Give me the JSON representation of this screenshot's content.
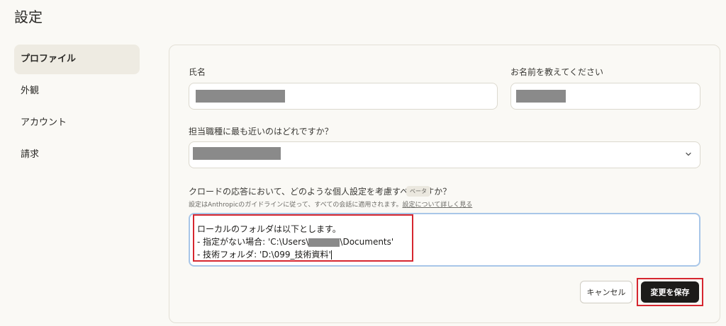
{
  "page": {
    "title": "設定"
  },
  "sidebar": {
    "items": [
      {
        "label": "プロファイル",
        "active": true
      },
      {
        "label": "外観",
        "active": false
      },
      {
        "label": "アカウント",
        "active": false
      },
      {
        "label": "請求",
        "active": false
      }
    ]
  },
  "profile": {
    "full_name_label": "氏名",
    "full_name_value": "",
    "nickname_label": "お名前を教えてください",
    "nickname_value": "",
    "role_label": "担当職種に最も近いのはどれですか？",
    "role_value": "",
    "preferences_label": "クロードの応答において、どのような個人設定を考慮すべきですか？",
    "beta_badge": "ベータ",
    "preferences_note": "設定はAnthropicのガイドラインに従って、すべての会話に適用されます。",
    "preferences_link": "設定について詳しく見る",
    "preferences_lines": [
      "ローカルのフォルダは以下とします。",
      "- 指定がない場合: 'C:\\Users\\",
      "\\Documents'",
      "- 技術フォルダ: 'D:\\099_技術資料'"
    ]
  },
  "buttons": {
    "cancel_label": "キャンセル",
    "save_label": "変更を保存"
  },
  "colors": {
    "background": "#faf9f5",
    "primary_button": "#1c1b19",
    "annotation_red": "#d6262f",
    "focus_border": "#a8c6e8",
    "redaction": "#8a8a8a"
  },
  "icons": {
    "role_select": "chevron-down-icon"
  }
}
